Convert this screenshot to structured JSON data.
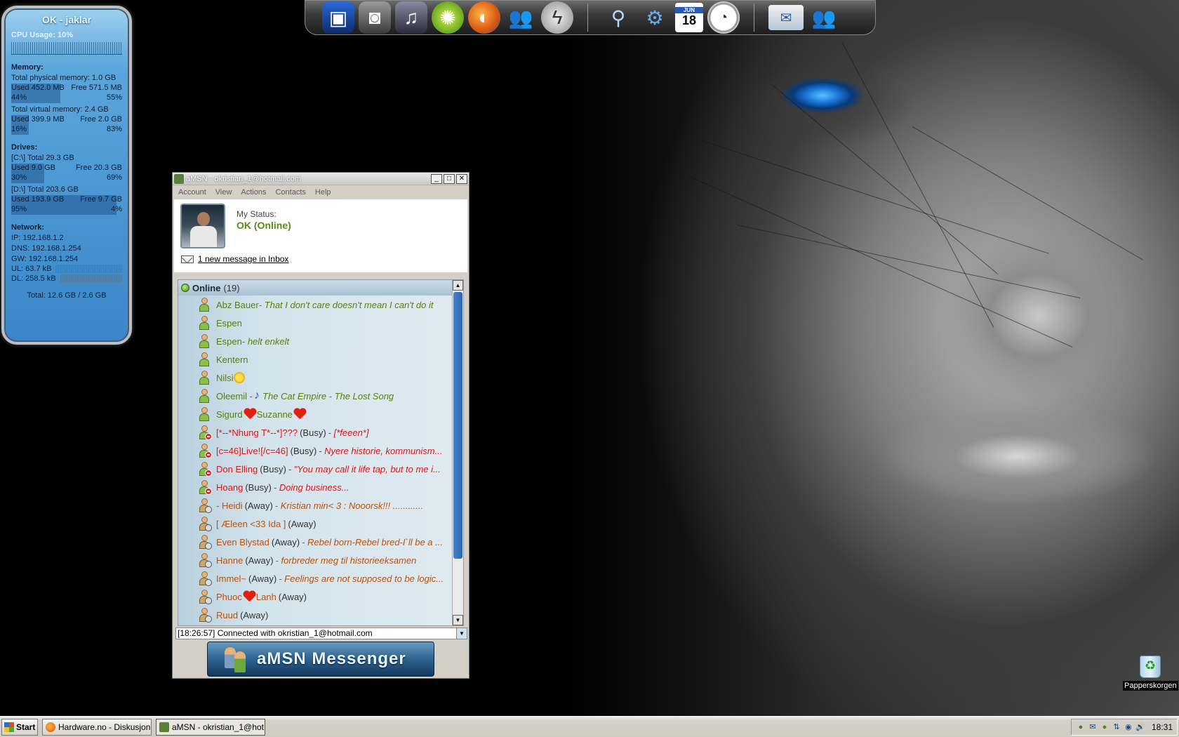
{
  "sysmon": {
    "title": "OK - jaklar",
    "cpu": "CPU Usage: 10%",
    "cpu_fraction": 0.1,
    "memory_heading": "Memory:",
    "physical_total": "Total physical memory: 1.0 GB",
    "physical": {
      "used": "Used 452.0 MB",
      "free": "Free 571.5 MB",
      "used_pct": "44%",
      "free_pct": "55%",
      "fill": 0.44
    },
    "virtual_total": "Total virtual memory: 2.4 GB",
    "virtual": {
      "used": "Used 399.9 MB",
      "free": "Free 2.0 GB",
      "used_pct": "16%",
      "free_pct": "83%",
      "fill": 0.16
    },
    "drives_heading": "Drives:",
    "drive_c_total": "[C:\\] Total 29.3 GB",
    "drive_c": {
      "used": "Used 9.0 GB",
      "free": "Free 20.3 GB",
      "used_pct": "30%",
      "free_pct": "69%",
      "fill": 0.3
    },
    "drive_d_total": "[D:\\] Total 203.6 GB",
    "drive_d": {
      "used": "Used 193.9 GB",
      "free": "Free 9.7 GB",
      "used_pct": "95%",
      "free_pct": "4%",
      "fill": 0.95
    },
    "network_heading": "Network:",
    "ip": "IP:     192.168.1.2",
    "dns": "DNS:  192.168.1.254",
    "gw": "GW:   192.168.1.254",
    "ul": "UL: 63.7 kB",
    "dl": "DL: 258.5 kB",
    "total": "Total: 12.6 GB / 2.6 GB"
  },
  "dock": {
    "icons": [
      "monitor-icon",
      "camera-icon",
      "music-icon",
      "media-player-icon",
      "firefox-icon",
      "messenger-icon",
      "power-icon",
      "search-icon",
      "settings-icon",
      "calendar-icon",
      "clock-icon",
      "mail-icon",
      "users-icon"
    ],
    "calendar_day": "18",
    "calendar_month": "JUN"
  },
  "amsn": {
    "title": "aMSN - okristian_1@hotmail.com",
    "menu": [
      "Account",
      "View",
      "Actions",
      "Contacts",
      "Help"
    ],
    "my_status_label": "My Status:",
    "my_status_value": "OK (Online)",
    "inbox_link": "1 new message in Inbox",
    "group": {
      "name": "Online",
      "count": "(19)"
    },
    "contacts": [
      {
        "status": "online",
        "name": "Abz Bauer",
        "psm": " - That I don't care doesn't mean I can't do it"
      },
      {
        "status": "online",
        "name": "Espen",
        "psm": ""
      },
      {
        "status": "online",
        "name": "Espen",
        "psm": " - helt enkelt"
      },
      {
        "status": "online",
        "name": "Kentern",
        "psm": ""
      },
      {
        "status": "online",
        "name": "Nilsi",
        "psm": "",
        "emoticon": "sun"
      },
      {
        "status": "online",
        "name": "Oleemil -",
        "psm": "The Cat Empire - The Lost Song",
        "emoticon": "note"
      },
      {
        "status": "online",
        "name": "Sigurd",
        "name2": "Suzanne",
        "psm": "",
        "emoticon": "heart"
      },
      {
        "status": "busy",
        "name": "[*--*Nhung T*--*]???",
        "state": "(Busy)",
        "psm": " - [*feeen*]"
      },
      {
        "status": "busy",
        "name": "[c=46]Live![/c=46]",
        "state": "(Busy)",
        "psm": " - Nyere historie, kommunism..."
      },
      {
        "status": "busy",
        "name": "Don Elling",
        "state": "(Busy)",
        "psm": " - \"You may call it life tap, but to me i..."
      },
      {
        "status": "busy",
        "name": "Hoang",
        "state": "(Busy)",
        "psm": " - Doing business..."
      },
      {
        "status": "away",
        "name": "- Heidi",
        "state": "(Away)",
        "psm": " - Kristian min< 3   :   Nooorsk!!!   ............"
      },
      {
        "status": "away",
        "name": "[ Æleen <33 Ida ]",
        "state": "(Away)",
        "psm": ""
      },
      {
        "status": "away",
        "name": "Even Blystad",
        "state": "(Away)",
        "psm": " - Rebel born-Rebel bred-I`ll be a ..."
      },
      {
        "status": "away",
        "name": "Hanne",
        "state": "(Away)",
        "psm": " - forbreder meg til historieeksamen"
      },
      {
        "status": "away",
        "name": "Immel~",
        "state": "(Away)",
        "psm": " - Feelings are not supposed to be logic..."
      },
      {
        "status": "away",
        "name": "Phuoc",
        "name2": "Lanh",
        "state": "(Away)",
        "psm": "",
        "emoticon": "heart"
      },
      {
        "status": "away",
        "name": "Ruud",
        "state": "(Away)",
        "psm": ""
      }
    ],
    "status_line": "[18:26:57] Connected with okristian_1@hotmail.com",
    "banner": "aMSN Messenger"
  },
  "desktop": {
    "recycle_label": "Papperskorgen"
  },
  "taskbar": {
    "start": "Start",
    "tasks": [
      "Hardware.no - Diskusjon...",
      "aMSN - okristian_1@hot..."
    ],
    "clock": "18:31"
  },
  "colors": {
    "online": "#5a7d12",
    "busy": "#d81818",
    "away": "#b8520e",
    "accent": "#2a66b0"
  }
}
